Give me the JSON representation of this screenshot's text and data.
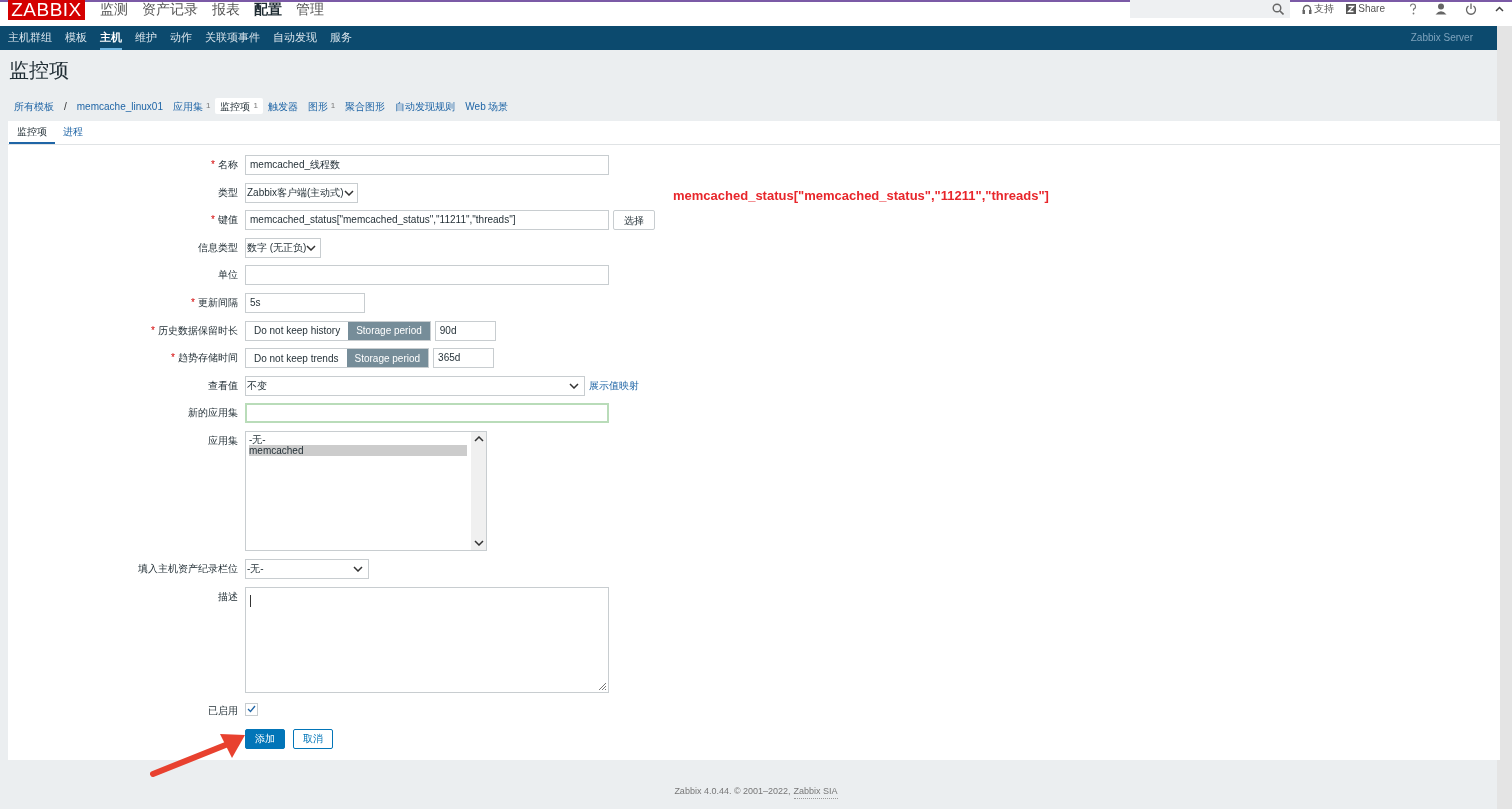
{
  "top_menu": [
    {
      "label": "监测",
      "selected": false
    },
    {
      "label": "资产记录",
      "selected": false
    },
    {
      "label": "报表",
      "selected": false
    },
    {
      "label": "配置",
      "selected": true
    },
    {
      "label": "管理",
      "selected": false
    }
  ],
  "logo": "ZABBIX",
  "header_links": [
    {
      "label": "支持",
      "kind": "support"
    },
    {
      "label": "Share",
      "kind": "share"
    }
  ],
  "sub_menu": [
    {
      "label": "主机群组",
      "selected": false
    },
    {
      "label": "模板",
      "selected": false
    },
    {
      "label": "主机",
      "selected": true
    },
    {
      "label": "维护",
      "selected": false
    },
    {
      "label": "动作",
      "selected": false
    },
    {
      "label": "关联项事件",
      "selected": false
    },
    {
      "label": "自动发现",
      "selected": false
    },
    {
      "label": "服务",
      "selected": false
    }
  ],
  "server_name": "Zabbix Server",
  "page_title": "监控项",
  "breadcrumb_separator": "/",
  "breadcrumbs": [
    {
      "label": "所有模板",
      "selected": false
    },
    {
      "label": "memcache_linux01",
      "selected": false
    },
    {
      "label": "应用集",
      "count": "1",
      "selected": false
    },
    {
      "label": "监控项",
      "count": "1",
      "selected": true
    },
    {
      "label": "触发器",
      "selected": false
    },
    {
      "label": "图形",
      "count": "1",
      "selected": false
    },
    {
      "label": "聚合图形",
      "selected": false
    },
    {
      "label": "自动发现规则",
      "selected": false
    },
    {
      "label": "Web 场景",
      "selected": false
    }
  ],
  "tabs": [
    {
      "label": "监控项",
      "selected": true
    },
    {
      "label": "进程",
      "selected": false
    }
  ],
  "form": {
    "fields": [
      {
        "label": "名称",
        "required_mark": "*",
        "kind": "text",
        "value": "memcached_线程数"
      },
      {
        "label": "类型",
        "kind": "select",
        "value": "Zabbix客户端(主动式)"
      },
      {
        "label": "键值",
        "required_mark": "*",
        "kind": "text_button",
        "value": "memcached_status[\"memcached_status\",\"11211\",\"threads\"]",
        "button": "选择"
      },
      {
        "label": "信息类型",
        "kind": "select",
        "value": "数字 (无正负)"
      },
      {
        "label": "单位",
        "kind": "text"
      },
      {
        "label": "更新间隔",
        "required_mark": "*",
        "kind": "short_text",
        "value": "5s"
      },
      {
        "label": "历史数据保留时长",
        "required_mark": "*",
        "kind": "segmented",
        "options": [
          {
            "label": "Do not keep history",
            "selected": false
          },
          {
            "label": "Storage period",
            "selected": true
          }
        ],
        "value": "90d"
      },
      {
        "label": "趋势存储时间",
        "required_mark": "*",
        "kind": "segmented",
        "options": [
          {
            "label": "Do not keep trends",
            "selected": false
          },
          {
            "label": "Storage period",
            "selected": true
          }
        ],
        "value": "365d"
      },
      {
        "label": "查看值",
        "kind": "select",
        "value": "不变",
        "link": "展示值映射"
      },
      {
        "label": "新的应用集",
        "kind": "text",
        "focused": true
      },
      {
        "label": "应用集",
        "kind": "listbox",
        "options": [
          {
            "label": "-无-",
            "selected": false
          },
          {
            "label": "memcached",
            "selected": true
          }
        ]
      },
      {
        "label": "填入主机资产纪录栏位",
        "kind": "select",
        "value": "-无-"
      },
      {
        "label": "描述",
        "kind": "textarea"
      },
      {
        "label": "已启用",
        "kind": "checkbox",
        "checked": true
      }
    ]
  },
  "buttons": [
    {
      "label": "添加",
      "kind": "primary"
    },
    {
      "label": "取消",
      "kind": "secondary"
    }
  ],
  "annotation": {
    "text": "memcached_status[\"memcached_status\",\"11211\",\"threads\"]"
  },
  "footer": {
    "text": "Zabbix 4.0.44. © 2001–2022,",
    "link": "Zabbix SIA"
  }
}
